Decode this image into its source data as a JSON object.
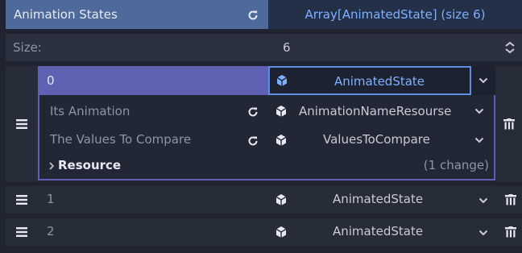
{
  "header": {
    "title": "Animation States",
    "type_label": "Array[AnimatedState] (size 6)"
  },
  "size_row": {
    "label": "Size:",
    "value": "6"
  },
  "elements": [
    {
      "index": "0",
      "value": "AnimatedState",
      "expanded": true,
      "properties": [
        {
          "label": "Its Animation",
          "value": "AnimationNameResourse"
        },
        {
          "label": "The Values To Compare",
          "value": "ValuesToCompare"
        }
      ],
      "resource": {
        "label": "Resource",
        "changes": "(1 change)"
      }
    },
    {
      "index": "1",
      "value": "AnimatedState"
    },
    {
      "index": "2",
      "value": "AnimatedState"
    }
  ],
  "icons": {
    "revert": "revert-icon",
    "resource": "resource-cube-icon",
    "dropdown": "chevron-down-icon",
    "spin": "spinner-arrows-icon",
    "drag": "drag-handle-icon",
    "delete": "trash-icon",
    "chevron_right": "chevron-right-icon"
  },
  "colors": {
    "header_bg": "#4d6a9b",
    "selected_bg": "#5f61b3",
    "focus_border": "#5d8fe0",
    "accent_text": "#7fb0ff"
  }
}
